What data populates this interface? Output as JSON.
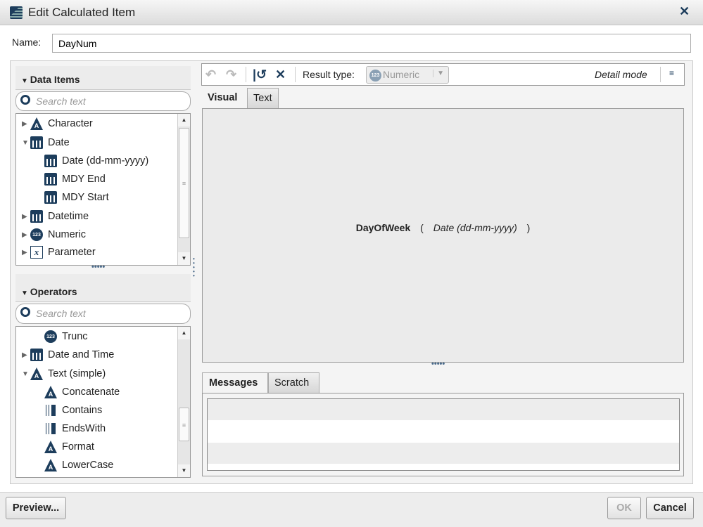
{
  "dialog": {
    "title": "Edit Calculated Item",
    "name_label": "Name:",
    "name_value": "DayNum"
  },
  "data_items": {
    "header": "Data Items",
    "search_placeholder": "Search text",
    "items": [
      {
        "label": "Character",
        "icon": "character-icon",
        "level": 0,
        "expander": "▶"
      },
      {
        "label": "Date",
        "icon": "date-icon",
        "level": 0,
        "expander": "▼"
      },
      {
        "label": "Date (dd-mm-yyyy)",
        "icon": "date-icon",
        "level": 1
      },
      {
        "label": "MDY End",
        "icon": "date-icon",
        "level": 1
      },
      {
        "label": "MDY Start",
        "icon": "date-icon",
        "level": 1
      },
      {
        "label": "Datetime",
        "icon": "datetime-icon",
        "level": 0,
        "expander": "▶"
      },
      {
        "label": "Numeric",
        "icon": "numeric-icon",
        "level": 0,
        "expander": "▶"
      },
      {
        "label": "Parameter",
        "icon": "parameter-icon",
        "level": 0,
        "expander": "▶"
      }
    ]
  },
  "operators": {
    "header": "Operators",
    "search_placeholder": "Search text",
    "items": [
      {
        "label": "Trunc",
        "icon": "numeric-icon",
        "level": 1
      },
      {
        "label": "Date and Time",
        "icon": "datetime-icon",
        "level": 0,
        "expander": "▶"
      },
      {
        "label": "Text (simple)",
        "icon": "character-icon",
        "level": 0,
        "expander": "▼"
      },
      {
        "label": "Concatenate",
        "icon": "character-icon",
        "level": 1
      },
      {
        "label": "Contains",
        "icon": "boolean-icon",
        "level": 1
      },
      {
        "label": "EndsWith",
        "icon": "boolean-icon",
        "level": 1
      },
      {
        "label": "Format",
        "icon": "character-icon",
        "level": 1
      },
      {
        "label": "LowerCase",
        "icon": "character-icon",
        "level": 1
      }
    ]
  },
  "toolbar": {
    "result_type_label": "Result type:",
    "result_type_value": "Numeric",
    "detail_mode": "Detail mode"
  },
  "editor_tabs": [
    "Visual",
    "Text"
  ],
  "expression": {
    "function": "DayOfWeek",
    "open": "(",
    "argument": "Date (dd-mm-yyyy)",
    "close": ")"
  },
  "message_tabs": [
    "Messages",
    "Scratch"
  ],
  "buttons": {
    "preview": "Preview...",
    "ok": "OK",
    "cancel": "Cancel"
  },
  "colors": {
    "accent": "#1d3d5c"
  }
}
